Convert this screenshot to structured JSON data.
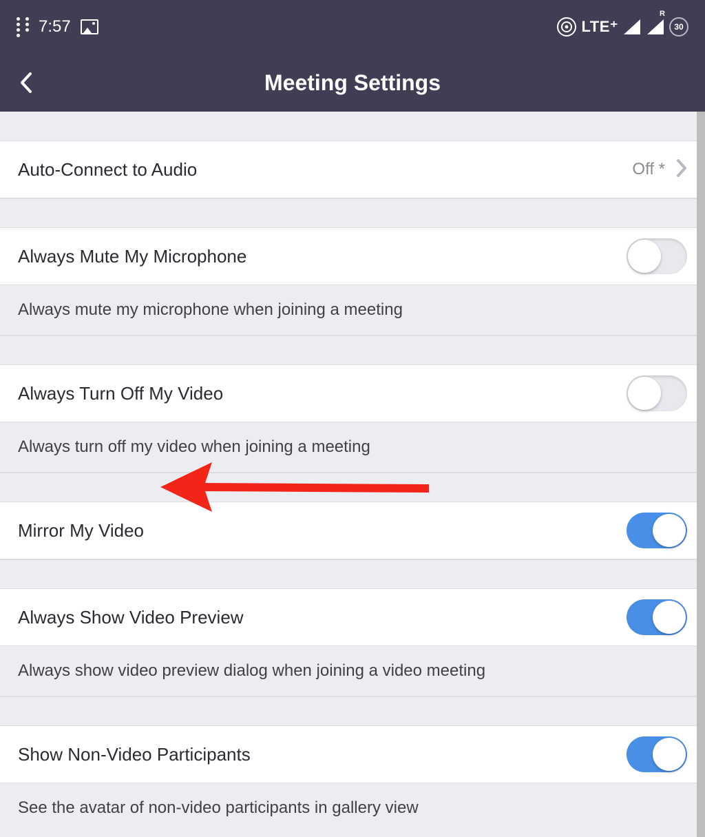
{
  "statusbar": {
    "time": "7:57",
    "network_label": "LTE⁺",
    "roaming_badge": "R",
    "battery_text": "30"
  },
  "header": {
    "title": "Meeting Settings"
  },
  "rows": {
    "auto_connect": {
      "label": "Auto-Connect to Audio",
      "value": "Off *"
    },
    "mute_mic": {
      "label": "Always Mute My Microphone",
      "desc": "Always mute my microphone when joining a meeting"
    },
    "off_video": {
      "label": "Always Turn Off My Video",
      "desc": "Always turn off my video when joining a meeting"
    },
    "mirror": {
      "label": "Mirror My Video"
    },
    "preview": {
      "label": "Always Show Video Preview",
      "desc": "Always show video preview dialog when joining a video meeting"
    },
    "nonvideo": {
      "label": "Show Non-Video Participants",
      "desc": "See the avatar of non-video participants in gallery view"
    }
  }
}
